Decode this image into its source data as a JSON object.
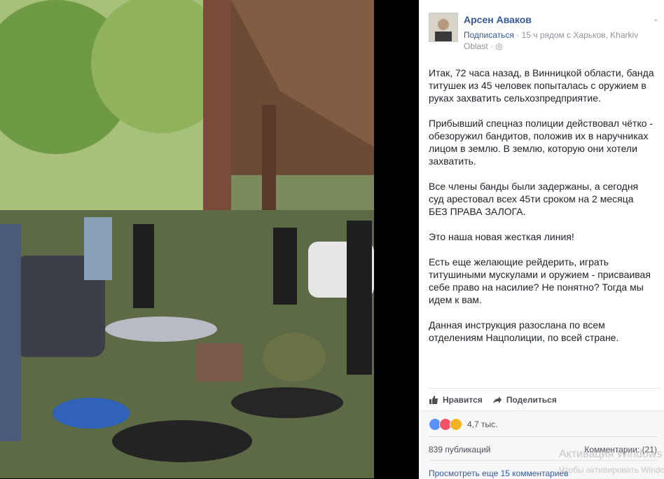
{
  "post": {
    "author": "Арсен Аваков",
    "subscribe": "Подписаться",
    "meta_rest": " · 15 ч рядом с Харьков, Kharkiv Oblast · ",
    "paragraphs": [
      "Итак, 72 часа назад, в Винницкой области, банда титушек из 45 человек попыталась с оружием в руках захватить сельхозпредприятие.",
      "Прибывший спецназ полиции действовал чётко - обезоружил бандитов, положив их в наручниках лицом в землю. В землю, которую они хотели захватить.",
      "Все члены банды были задержаны, а сегодня суд арестовал всех 45ти сроком на 2 месяца БЕЗ ПРАВА ЗАЛОГА.",
      "Это наша новая жесткая линия!",
      "Есть еще желающие рейдерить, играть титушиными мускулами и оружием - присваивая себе право на насилие? Не понятно? Тогда мы идем к вам.",
      "Данная инструкция разослана по всем отделениям Нацполиции, по всей стране."
    ]
  },
  "actions": {
    "like": "Нравится",
    "share": "Поделиться"
  },
  "stats": {
    "reactions_count": "4,7 тыс.",
    "shares": "839 публикаций",
    "comments": "Комментарии: (21)",
    "more_comments": "Просмотреть еще 15 комментариев"
  },
  "watermark": {
    "line1": "Активация Windows",
    "line2": "Чтобы активировать Windows"
  },
  "colors": {
    "link": "#365899",
    "like": "#5890ff",
    "love": "#f25268",
    "wow": "#f7b125"
  }
}
